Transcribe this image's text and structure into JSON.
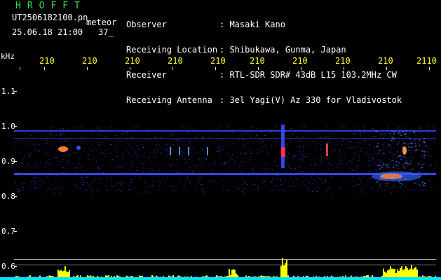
{
  "header": {
    "app_title": "HROFFT",
    "file_name": "UT2506182100.pn",
    "meteor_label": "meteor",
    "timestamp": "25.06.18 21:00",
    "count": "37_",
    "info": [
      {
        "label": "Observer",
        "value": ": Masaki Kano"
      },
      {
        "label": "Receiving Location",
        "value": ": Shibukawa, Gunma, Japan"
      },
      {
        "label": "Receiver",
        "value": ": RTL-SDR SDR# 43dB L15 103.2MHz CW"
      },
      {
        "label": "Receiving Antenna",
        "value": ": 3el Yagi(V) Az 330 for Vladivostok"
      }
    ]
  },
  "axes": {
    "unit": "kHz",
    "x_ticks": [
      "210",
      "210",
      "210",
      "210",
      "210",
      "210",
      "210",
      "210",
      "210",
      "2110"
    ],
    "y_ticks": [
      "1.1",
      "1.0",
      "0.9",
      "0.8",
      "0.7",
      "0.6"
    ]
  },
  "colors": {
    "background": "#000000",
    "label_green": "#33e04a",
    "label_white": "#ffffff",
    "axis_yellow": "#ffff33",
    "noise_band": "#3b4cff",
    "hot_spot": "#ff2d55",
    "histogram": "#ffff00",
    "baseline": "#00e5ff"
  }
}
